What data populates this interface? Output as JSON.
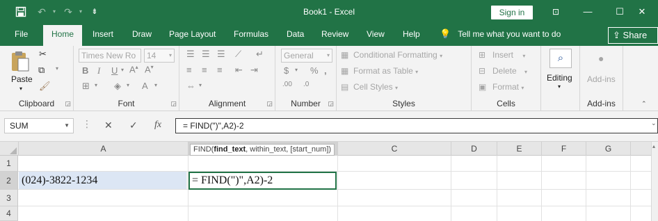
{
  "app": {
    "title": "Book1  -  Excel",
    "sign_in": "Sign in"
  },
  "quick_access": {
    "save_icon": "save-icon",
    "undo_icon": "undo-icon",
    "redo_icon": "redo-icon",
    "customize_icon": "customize-icon"
  },
  "window": {
    "ribbon_display_icon": "ribbon-display-icon",
    "minimize": "—",
    "restore": "☐",
    "close": "✕"
  },
  "tabs": [
    "File",
    "Home",
    "Insert",
    "Draw",
    "Page Layout",
    "Formulas",
    "Data",
    "Review",
    "View",
    "Help"
  ],
  "active_tab": "Home",
  "tell_me": "Tell me what you want to do",
  "share": "Share",
  "ribbon": {
    "clipboard": {
      "label": "Clipboard",
      "paste": "Paste"
    },
    "font": {
      "label": "Font",
      "font_name": "Times New Ro",
      "font_size": "14"
    },
    "alignment": {
      "label": "Alignment"
    },
    "number": {
      "label": "Number",
      "format": "General"
    },
    "styles": {
      "label": "Styles",
      "conditional_formatting": "Conditional Formatting",
      "format_as_table": "Format as Table",
      "cell_styles": "Cell Styles"
    },
    "cells": {
      "label": "Cells",
      "insert": "Insert",
      "delete": "Delete",
      "format": "Format"
    },
    "editing": {
      "label": "Editing"
    },
    "addins": {
      "label": "Add-ins",
      "button": "Add-ins"
    }
  },
  "formula_bar": {
    "name_box": "SUM",
    "cancel": "✕",
    "enter": "✓",
    "fx": "fx",
    "formula": "= FIND(\")\",A2)-2"
  },
  "tooltip": {
    "func": "FIND(",
    "arg_bold": "find_text",
    "rest": ", within_text, [start_num])"
  },
  "columns": [
    "A",
    "B",
    "C",
    "D",
    "E",
    "F",
    "G"
  ],
  "rows": [
    "1",
    "2",
    "3",
    "4"
  ],
  "cells": {
    "A2": "(024)-3822-1234",
    "B2": "= FIND(\")\",A2)-2"
  },
  "colors": {
    "brand": "#217346",
    "selected_cell_fill": "#dce6f4"
  }
}
